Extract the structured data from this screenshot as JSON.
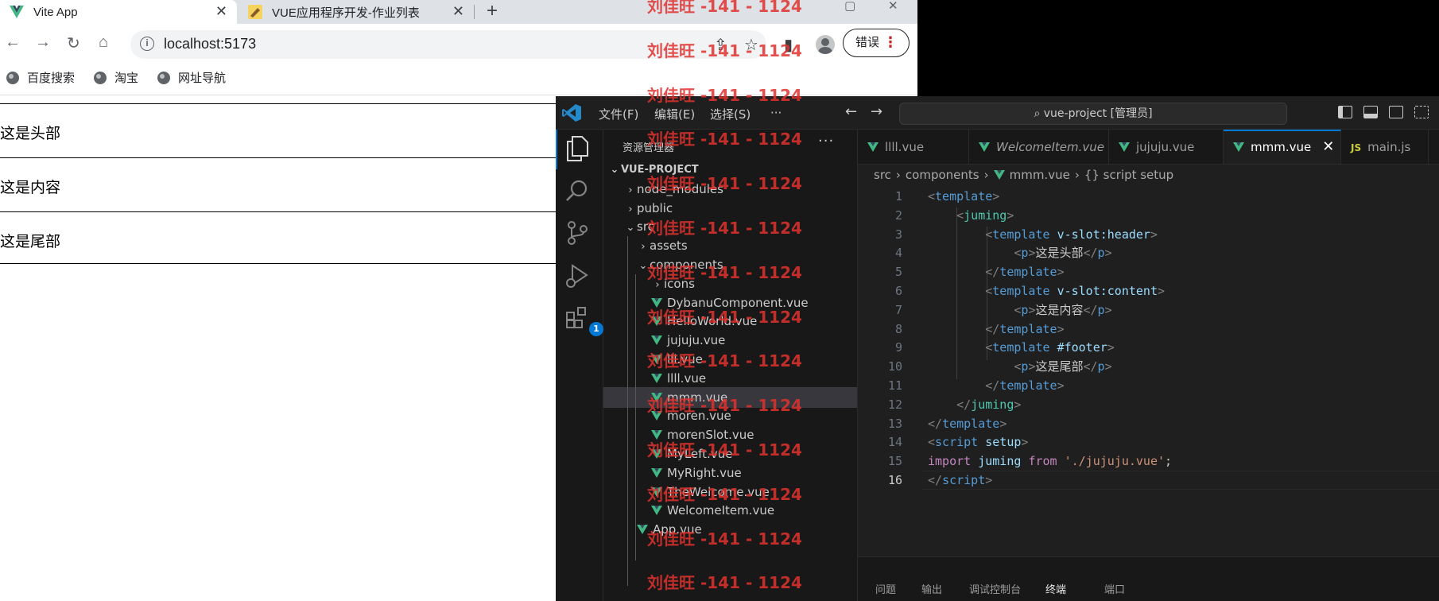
{
  "browser": {
    "tabs": [
      {
        "title": "Vite App",
        "icon": "vue-logo-icon"
      },
      {
        "title": "VUE应用程序开发-作业列表",
        "icon": "tab-favicon-icon"
      }
    ],
    "new_tab": "+",
    "url": "localhost:5173",
    "error_label": "错误",
    "bookmarks": [
      "百度搜索",
      "淘宝",
      "网址导航"
    ],
    "page_blocks": [
      "这是头部",
      "这是内容",
      "这是尾部"
    ]
  },
  "vscode": {
    "menus": [
      "文件(F)",
      "编辑(E)",
      "选择(S)",
      "···"
    ],
    "command_center": "vue-project [管理员]",
    "extensions_badge": "1",
    "sidebar": {
      "title": "资源管理器",
      "more": "···",
      "tree": [
        {
          "label": "VUE-PROJECT",
          "chev": "⌄",
          "depth": 0,
          "type": "header"
        },
        {
          "label": "node_modules",
          "chev": "›",
          "depth": 1,
          "type": "folder"
        },
        {
          "label": "public",
          "chev": "›",
          "depth": 1,
          "type": "folder"
        },
        {
          "label": "src",
          "chev": "⌄",
          "depth": 1,
          "type": "folder"
        },
        {
          "label": "assets",
          "chev": "›",
          "depth": 2,
          "type": "folder"
        },
        {
          "label": "components",
          "chev": "⌄",
          "depth": 2,
          "type": "folder"
        },
        {
          "label": "icons",
          "chev": "›",
          "depth": 3,
          "type": "folder"
        },
        {
          "label": "DybanuComponent.vue",
          "depth": 3,
          "type": "vue"
        },
        {
          "label": "HelloWorld.vue",
          "depth": 3,
          "type": "vue"
        },
        {
          "label": "jujuju.vue",
          "depth": 3,
          "type": "vue"
        },
        {
          "label": "lll.vue",
          "depth": 3,
          "type": "vue"
        },
        {
          "label": "llll.vue",
          "depth": 3,
          "type": "vue"
        },
        {
          "label": "mmm.vue",
          "depth": 3,
          "type": "vue",
          "selected": true
        },
        {
          "label": "moren.vue",
          "depth": 3,
          "type": "vue"
        },
        {
          "label": "morenSlot.vue",
          "depth": 3,
          "type": "vue"
        },
        {
          "label": "MyLeft.vue",
          "depth": 3,
          "type": "vue"
        },
        {
          "label": "MyRight.vue",
          "depth": 3,
          "type": "vue"
        },
        {
          "label": "TheWelcome.vue",
          "depth": 3,
          "type": "vue"
        },
        {
          "label": "WelcomeItem.vue",
          "depth": 3,
          "type": "vue"
        },
        {
          "label": "App.vue",
          "depth": 2,
          "type": "vue"
        }
      ]
    },
    "editor_tabs": [
      {
        "label": "llll.vue",
        "type": "vue"
      },
      {
        "label": "WelcomeItem.vue",
        "type": "vue",
        "italic": true
      },
      {
        "label": "jujuju.vue",
        "type": "vue"
      },
      {
        "label": "mmm.vue",
        "type": "vue",
        "active": true,
        "close": "✕"
      },
      {
        "label": "main.js",
        "type": "js",
        "js": "JS"
      }
    ],
    "breadcrumbs": [
      "src",
      "components",
      "mmm.vue",
      "{} script setup"
    ],
    "breadcrumb_sep": "›",
    "code_lines": [
      [
        {
          "t": "<",
          "c": "tg"
        },
        {
          "t": "template",
          "c": "tn"
        },
        {
          "t": ">",
          "c": "tg"
        }
      ],
      [
        {
          "t": "    "
        },
        {
          "t": "<",
          "c": "tg"
        },
        {
          "t": "juming",
          "c": "tc"
        },
        {
          "t": ">",
          "c": "tg"
        }
      ],
      [
        {
          "t": "        "
        },
        {
          "t": "<",
          "c": "tg"
        },
        {
          "t": "template",
          "c": "tn"
        },
        {
          "t": " "
        },
        {
          "t": "v-slot:header",
          "c": "at"
        },
        {
          "t": ">",
          "c": "tg"
        }
      ],
      [
        {
          "t": "            "
        },
        {
          "t": "<",
          "c": "tg"
        },
        {
          "t": "p",
          "c": "tn"
        },
        {
          "t": ">",
          "c": "tg"
        },
        {
          "t": "这是头部",
          "c": "tx"
        },
        {
          "t": "</",
          "c": "tg"
        },
        {
          "t": "p",
          "c": "tn"
        },
        {
          "t": ">",
          "c": "tg"
        }
      ],
      [
        {
          "t": "        "
        },
        {
          "t": "</",
          "c": "tg"
        },
        {
          "t": "template",
          "c": "tn"
        },
        {
          "t": ">",
          "c": "tg"
        }
      ],
      [
        {
          "t": "        "
        },
        {
          "t": "<",
          "c": "tg"
        },
        {
          "t": "template",
          "c": "tn"
        },
        {
          "t": " "
        },
        {
          "t": "v-slot:content",
          "c": "at"
        },
        {
          "t": ">",
          "c": "tg"
        }
      ],
      [
        {
          "t": "            "
        },
        {
          "t": "<",
          "c": "tg"
        },
        {
          "t": "p",
          "c": "tn"
        },
        {
          "t": ">",
          "c": "tg"
        },
        {
          "t": "这是内容",
          "c": "tx"
        },
        {
          "t": "</",
          "c": "tg"
        },
        {
          "t": "p",
          "c": "tn"
        },
        {
          "t": ">",
          "c": "tg"
        }
      ],
      [
        {
          "t": "        "
        },
        {
          "t": "</",
          "c": "tg"
        },
        {
          "t": "template",
          "c": "tn"
        },
        {
          "t": ">",
          "c": "tg"
        }
      ],
      [
        {
          "t": "        "
        },
        {
          "t": "<",
          "c": "tg"
        },
        {
          "t": "template",
          "c": "tn"
        },
        {
          "t": " "
        },
        {
          "t": "#footer",
          "c": "at"
        },
        {
          "t": ">",
          "c": "tg"
        }
      ],
      [
        {
          "t": "            "
        },
        {
          "t": "<",
          "c": "tg"
        },
        {
          "t": "p",
          "c": "tn"
        },
        {
          "t": ">",
          "c": "tg"
        },
        {
          "t": "这是尾部",
          "c": "tx"
        },
        {
          "t": "</",
          "c": "tg"
        },
        {
          "t": "p",
          "c": "tn"
        },
        {
          "t": ">",
          "c": "tg"
        }
      ],
      [
        {
          "t": "        "
        },
        {
          "t": "</",
          "c": "tg"
        },
        {
          "t": "template",
          "c": "tn"
        },
        {
          "t": ">",
          "c": "tg"
        }
      ],
      [
        {
          "t": "    "
        },
        {
          "t": "</",
          "c": "tg"
        },
        {
          "t": "juming",
          "c": "tc"
        },
        {
          "t": ">",
          "c": "tg"
        }
      ],
      [
        {
          "t": "</",
          "c": "tg"
        },
        {
          "t": "template",
          "c": "tn"
        },
        {
          "t": ">",
          "c": "tg"
        }
      ],
      [
        {
          "t": "<",
          "c": "tg"
        },
        {
          "t": "script",
          "c": "tn"
        },
        {
          "t": " "
        },
        {
          "t": "setup",
          "c": "at"
        },
        {
          "t": ">",
          "c": "tg"
        }
      ],
      [
        {
          "t": "import",
          "c": "kw"
        },
        {
          "t": " "
        },
        {
          "t": "juming",
          "c": "at"
        },
        {
          "t": " "
        },
        {
          "t": "from",
          "c": "kw"
        },
        {
          "t": " "
        },
        {
          "t": "'./jujuju.vue'",
          "c": "str"
        },
        {
          "t": ";",
          "c": "tx"
        }
      ],
      [
        {
          "t": "</",
          "c": "tg"
        },
        {
          "t": "script",
          "c": "tn"
        },
        {
          "t": ">",
          "c": "tg"
        }
      ]
    ],
    "current_line": 16,
    "panel_tabs": [
      "问题",
      "输出",
      "调试控制台",
      "终端",
      "端口"
    ]
  },
  "watermark": "刘佳旺 -141 - 1124",
  "colors": {
    "vue_green": "#41b883",
    "accent_blue": "#0078d4",
    "watermark_red": "#e0322e"
  }
}
